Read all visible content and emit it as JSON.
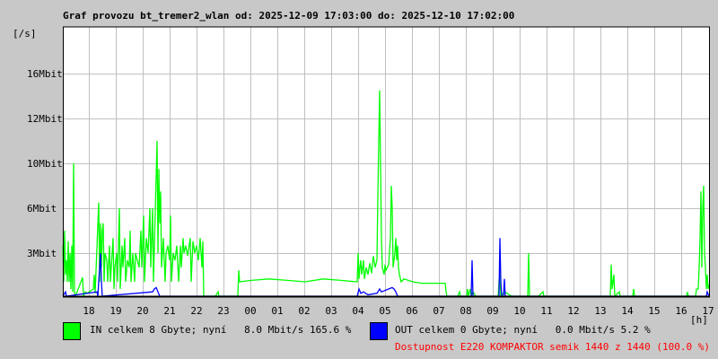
{
  "chart_data": {
    "type": "line",
    "title": "Graf provozu bt_tremer2_wlan od: 2025-12-09 17:03:00 do: 2025-12-10 17:02:00",
    "ylabel": "[/s]",
    "xlabel": "[h]",
    "x_unit": "minutes since 17:03",
    "xlim": [
      0,
      1440
    ],
    "ylim": [
      0,
      20
    ],
    "grid": true,
    "y_ticks": [
      {
        "value": 3,
        "label": "3Mbit"
      },
      {
        "value": 6,
        "label": "6Mbit"
      },
      {
        "value": 10,
        "label": "10Mbit"
      },
      {
        "value": 12,
        "label": "12Mbit"
      },
      {
        "value": 16,
        "label": "16Mbit"
      }
    ],
    "x_ticks": [
      "18",
      "19",
      "20",
      "21",
      "22",
      "23",
      "00",
      "01",
      "02",
      "03",
      "04",
      "05",
      "06",
      "07",
      "08",
      "09",
      "10",
      "11",
      "12",
      "13",
      "14",
      "15",
      "16",
      "17"
    ],
    "series": [
      {
        "name": "IN",
        "color": "#00ff00",
        "points": [
          [
            0,
            3.5
          ],
          [
            2,
            1
          ],
          [
            4,
            4.5
          ],
          [
            6,
            1.5
          ],
          [
            8,
            2.5
          ],
          [
            10,
            1
          ],
          [
            12,
            3.8
          ],
          [
            14,
            1
          ],
          [
            16,
            3
          ],
          [
            18,
            0.5
          ],
          [
            20,
            3.5
          ],
          [
            22,
            0.3
          ],
          [
            24,
            10
          ],
          [
            26,
            0.3
          ],
          [
            28,
            0
          ],
          [
            44,
            1.3
          ],
          [
            46,
            0
          ],
          [
            50,
            0.3
          ],
          [
            54,
            0.2
          ],
          [
            68,
            0.5
          ],
          [
            70,
            1.5
          ],
          [
            72,
            0.2
          ],
          [
            80,
            6.5
          ],
          [
            82,
            1
          ],
          [
            84,
            5
          ],
          [
            86,
            2
          ],
          [
            88,
            4.5
          ],
          [
            90,
            5
          ],
          [
            92,
            1
          ],
          [
            94,
            3
          ],
          [
            98,
            2.5
          ],
          [
            100,
            1
          ],
          [
            104,
            3.5
          ],
          [
            106,
            1
          ],
          [
            112,
            4
          ],
          [
            114,
            0.5
          ],
          [
            116,
            2
          ],
          [
            120,
            3
          ],
          [
            122,
            1
          ],
          [
            126,
            6
          ],
          [
            128,
            0.5
          ],
          [
            132,
            3.5
          ],
          [
            134,
            2
          ],
          [
            138,
            4
          ],
          [
            140,
            1
          ],
          [
            144,
            2.5
          ],
          [
            148,
            2
          ],
          [
            150,
            4.5
          ],
          [
            152,
            1
          ],
          [
            156,
            3
          ],
          [
            160,
            1
          ],
          [
            162,
            3
          ],
          [
            166,
            2.5
          ],
          [
            170,
            2
          ],
          [
            174,
            4.5
          ],
          [
            176,
            2
          ],
          [
            180,
            5.5
          ],
          [
            182,
            1
          ],
          [
            186,
            4
          ],
          [
            190,
            3
          ],
          [
            194,
            6
          ],
          [
            196,
            2
          ],
          [
            200,
            6
          ],
          [
            202,
            1
          ],
          [
            210,
            11
          ],
          [
            212,
            3
          ],
          [
            214,
            9.5
          ],
          [
            216,
            5
          ],
          [
            218,
            7.5
          ],
          [
            220,
            2
          ],
          [
            224,
            4
          ],
          [
            228,
            1
          ],
          [
            230,
            3
          ],
          [
            234,
            3.5
          ],
          [
            238,
            2.5
          ],
          [
            240,
            5.5
          ],
          [
            242,
            1
          ],
          [
            246,
            3
          ],
          [
            250,
            2.5
          ],
          [
            254,
            3.5
          ],
          [
            258,
            1
          ],
          [
            262,
            3.5
          ],
          [
            264,
            2
          ],
          [
            268,
            4
          ],
          [
            270,
            3
          ],
          [
            274,
            3.5
          ],
          [
            278,
            2.8
          ],
          [
            284,
            4
          ],
          [
            286,
            1
          ],
          [
            290,
            3.8
          ],
          [
            294,
            3
          ],
          [
            298,
            3.5
          ],
          [
            302,
            2.5
          ],
          [
            306,
            4
          ],
          [
            310,
            2
          ],
          [
            312,
            3.8
          ],
          [
            314,
            0
          ],
          [
            340,
            0
          ],
          [
            346,
            0.3
          ],
          [
            348,
            0
          ],
          [
            390,
            0
          ],
          [
            392,
            1.8
          ],
          [
            394,
            1
          ],
          [
            420,
            1.1
          ],
          [
            460,
            1.2
          ],
          [
            500,
            1.1
          ],
          [
            540,
            1.0
          ],
          [
            580,
            1.2
          ],
          [
            620,
            1.1
          ],
          [
            656,
            1.0
          ],
          [
            658,
            3
          ],
          [
            660,
            1.2
          ],
          [
            662,
            2
          ],
          [
            664,
            2.5
          ],
          [
            666,
            1.5
          ],
          [
            670,
            2.5
          ],
          [
            672,
            1.2
          ],
          [
            676,
            2
          ],
          [
            680,
            1.5
          ],
          [
            684,
            2.3
          ],
          [
            688,
            1.6
          ],
          [
            692,
            2.8
          ],
          [
            696,
            2
          ],
          [
            700,
            2.5
          ],
          [
            702,
            7
          ],
          [
            704,
            11
          ],
          [
            706,
            14.5
          ],
          [
            708,
            10
          ],
          [
            710,
            4
          ],
          [
            712,
            2
          ],
          [
            716,
            1.5
          ],
          [
            718,
            2.2
          ],
          [
            720,
            1.8
          ],
          [
            726,
            2.2
          ],
          [
            730,
            4
          ],
          [
            732,
            8
          ],
          [
            734,
            6
          ],
          [
            736,
            2
          ],
          [
            740,
            3
          ],
          [
            742,
            4
          ],
          [
            744,
            2.5
          ],
          [
            746,
            3.5
          ],
          [
            748,
            2
          ],
          [
            750,
            1.5
          ],
          [
            754,
            1
          ],
          [
            760,
            1.2
          ],
          [
            780,
            1.0
          ],
          [
            800,
            0.9
          ],
          [
            820,
            0.9
          ],
          [
            840,
            0.9
          ],
          [
            852,
            0.9
          ],
          [
            854,
            0.3
          ],
          [
            856,
            0
          ],
          [
            880,
            0
          ],
          [
            884,
            0.3
          ],
          [
            886,
            0
          ],
          [
            900,
            0
          ],
          [
            902,
            0.5
          ],
          [
            904,
            0
          ],
          [
            908,
            0.5
          ],
          [
            910,
            0
          ],
          [
            914,
            0.3
          ],
          [
            920,
            0
          ],
          [
            970,
            0
          ],
          [
            972,
            1
          ],
          [
            974,
            1.5
          ],
          [
            976,
            0
          ],
          [
            984,
            0.3
          ],
          [
            990,
            0.2
          ],
          [
            1000,
            0
          ],
          [
            1036,
            0
          ],
          [
            1038,
            3
          ],
          [
            1040,
            0
          ],
          [
            1060,
            0
          ],
          [
            1070,
            0.3
          ],
          [
            1072,
            0
          ],
          [
            1220,
            0
          ],
          [
            1222,
            2.2
          ],
          [
            1224,
            0.5
          ],
          [
            1228,
            1.5
          ],
          [
            1230,
            0
          ],
          [
            1240,
            0.3
          ],
          [
            1242,
            0
          ],
          [
            1270,
            0
          ],
          [
            1272,
            0.5
          ],
          [
            1274,
            0
          ],
          [
            1390,
            0
          ],
          [
            1392,
            0.3
          ],
          [
            1394,
            0
          ],
          [
            1410,
            0
          ],
          [
            1412,
            0.5
          ],
          [
            1416,
            0.5
          ],
          [
            1418,
            2
          ],
          [
            1420,
            4
          ],
          [
            1422,
            7.5
          ],
          [
            1424,
            2
          ],
          [
            1426,
            6
          ],
          [
            1428,
            8
          ],
          [
            1430,
            3
          ],
          [
            1432,
            2
          ],
          [
            1434,
            0.5
          ],
          [
            1436,
            1.5
          ],
          [
            1438,
            0.5
          ],
          [
            1440,
            0.8
          ]
        ]
      },
      {
        "name": "OUT",
        "color": "#0000ff",
        "points": [
          [
            0,
            0
          ],
          [
            6,
            0.3
          ],
          [
            8,
            0
          ],
          [
            76,
            0.3
          ],
          [
            78,
            0
          ],
          [
            84,
            3
          ],
          [
            86,
            1
          ],
          [
            88,
            0
          ],
          [
            200,
            0.3
          ],
          [
            204,
            0.5
          ],
          [
            208,
            0.6
          ],
          [
            212,
            0.3
          ],
          [
            216,
            0
          ],
          [
            656,
            0
          ],
          [
            660,
            0.5
          ],
          [
            664,
            0.2
          ],
          [
            670,
            0.3
          ],
          [
            680,
            0.1
          ],
          [
            700,
            0.2
          ],
          [
            706,
            0.5
          ],
          [
            710,
            0.3
          ],
          [
            734,
            0.6
          ],
          [
            738,
            0.5
          ],
          [
            742,
            0.3
          ],
          [
            746,
            0
          ],
          [
            910,
            0
          ],
          [
            912,
            2.5
          ],
          [
            914,
            0
          ],
          [
            972,
            0
          ],
          [
            974,
            4
          ],
          [
            976,
            1
          ],
          [
            978,
            0
          ],
          [
            982,
            0
          ],
          [
            984,
            1.2
          ],
          [
            986,
            0
          ],
          [
            1434,
            0
          ],
          [
            1436,
            0.3
          ],
          [
            1440,
            0
          ]
        ]
      }
    ]
  },
  "legend": {
    "in": "IN celkem 8 Gbyte; nyní   8.0 Mbit/s 165.6 %",
    "out": "OUT celkem 0 Gbyte; nyní   0.0 Mbit/s 5.2 %",
    "availability": "Dostupnost E220 KOMPAKTOR semik 1440 z 1440 (100.0 %)",
    "in_color": "#00ff00",
    "out_color": "#0000ff"
  }
}
